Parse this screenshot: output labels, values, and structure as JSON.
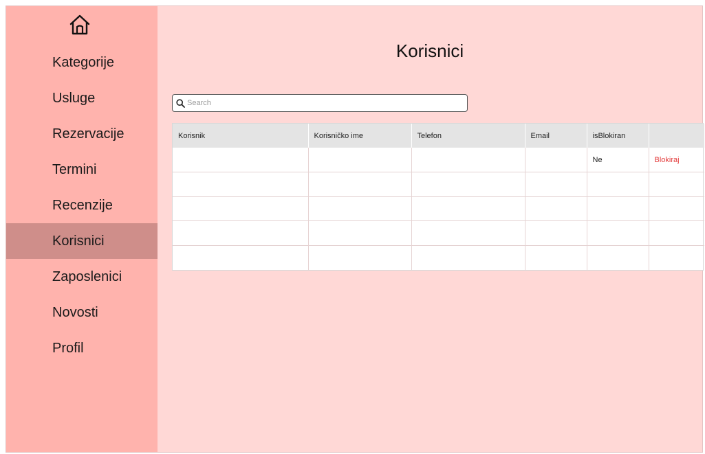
{
  "sidebar": {
    "home_icon": "home-icon",
    "items": [
      {
        "label": "Kategorije",
        "active": false
      },
      {
        "label": "Usluge",
        "active": false
      },
      {
        "label": "Rezervacije",
        "active": false
      },
      {
        "label": "Termini",
        "active": false
      },
      {
        "label": "Recenzije",
        "active": false
      },
      {
        "label": "Korisnici",
        "active": true
      },
      {
        "label": "Zaposlenici",
        "active": false
      },
      {
        "label": "Novosti",
        "active": false
      },
      {
        "label": "Profil",
        "active": false
      }
    ]
  },
  "main": {
    "title": "Korisnici",
    "search": {
      "placeholder": "Search",
      "value": ""
    },
    "table": {
      "columns": [
        "Korisnik",
        "Korisničko ime",
        "Telefon",
        "Email",
        "isBlokiran",
        ""
      ],
      "rows": [
        [
          "",
          "",
          "",
          "",
          "Ne",
          "Blokiraj"
        ],
        [
          "",
          "",
          "",
          "",
          "",
          ""
        ],
        [
          "",
          "",
          "",
          "",
          "",
          ""
        ],
        [
          "",
          "",
          "",
          "",
          "",
          ""
        ],
        [
          "",
          "",
          "",
          "",
          "",
          ""
        ]
      ]
    }
  },
  "colors": {
    "sidebar_bg": "#ffb3ad",
    "sidebar_active": "#cf8e8a",
    "main_bg": "#ffd8d6",
    "action_link": "#e33a3a"
  }
}
